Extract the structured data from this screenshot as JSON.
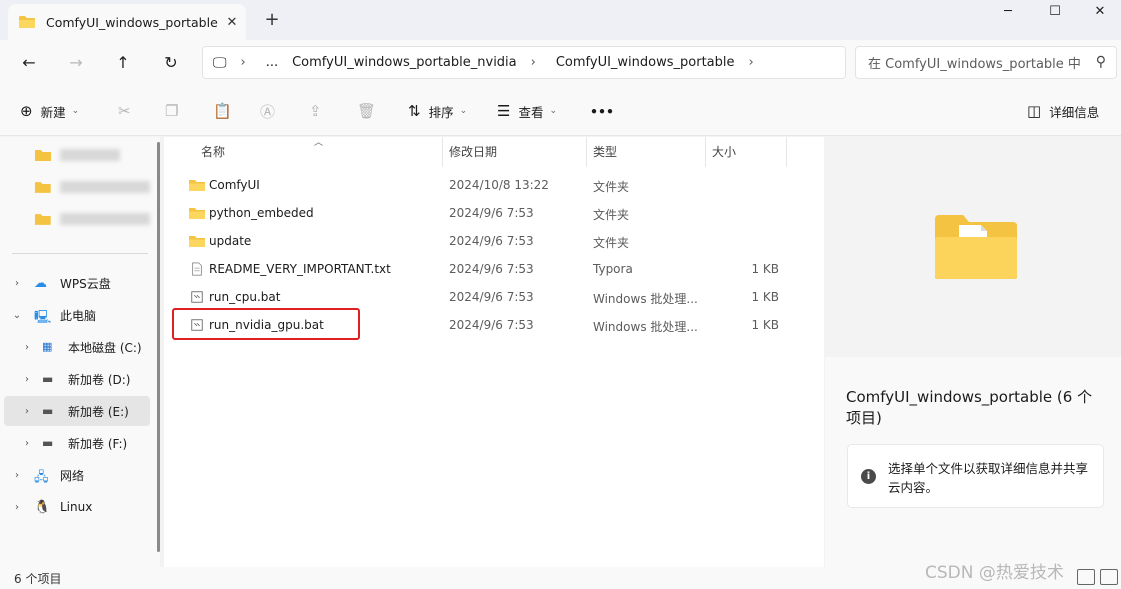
{
  "window": {
    "tab_title": "ComfyUI_windows_portable",
    "tab_close_icon": "close-icon",
    "new_tab_icon": "plus-icon",
    "controls": {
      "minimize": "─",
      "maximize": "☐",
      "close": "✕"
    }
  },
  "nav": {
    "back": "←",
    "forward": "→",
    "up": "↑",
    "refresh": "↻",
    "breadcrumb": [
      "...",
      "ComfyUI_windows_portable_nvidia",
      "ComfyUI_windows_portable"
    ],
    "search_placeholder": "在 ComfyUI_windows_portable 中"
  },
  "toolbar": {
    "new_label": "新建",
    "sort_label": "排序",
    "view_label": "查看",
    "more_label": "•••",
    "details_label": "详细信息"
  },
  "sidebar": {
    "quick_items": [
      {
        "label": "",
        "icon": "folder-icon"
      },
      {
        "label": "",
        "icon": "folder-icon"
      },
      {
        "label": "",
        "icon": "folder-icon"
      }
    ],
    "items": [
      {
        "label": "WPS云盘",
        "icon": "cloud-icon"
      },
      {
        "label": "此电脑",
        "icon": "pc-icon"
      },
      {
        "label": "本地磁盘 (C:)",
        "icon": "windows-drive-icon"
      },
      {
        "label": "新加卷 (D:)",
        "icon": "drive-icon"
      },
      {
        "label": "新加卷 (E:)",
        "icon": "drive-icon"
      },
      {
        "label": "新加卷 (F:)",
        "icon": "drive-icon"
      },
      {
        "label": "网络",
        "icon": "network-icon"
      },
      {
        "label": "Linux",
        "icon": "linux-icon"
      }
    ]
  },
  "columns": {
    "name": "名称",
    "date": "修改日期",
    "type": "类型",
    "size": "大小"
  },
  "files": [
    {
      "name": "ComfyUI",
      "date": "2024/10/8 13:22",
      "type": "文件夹",
      "size": "",
      "icon": "folder-icon"
    },
    {
      "name": "python_embeded",
      "date": "2024/9/6 7:53",
      "type": "文件夹",
      "size": "",
      "icon": "folder-icon"
    },
    {
      "name": "update",
      "date": "2024/9/6 7:53",
      "type": "文件夹",
      "size": "",
      "icon": "folder-icon"
    },
    {
      "name": "README_VERY_IMPORTANT.txt",
      "date": "2024/9/6 7:53",
      "type": "Typora",
      "size": "1 KB",
      "icon": "text-file-icon"
    },
    {
      "name": "run_cpu.bat",
      "date": "2024/9/6 7:53",
      "type": "Windows 批处理...",
      "size": "1 KB",
      "icon": "bat-file-icon"
    },
    {
      "name": "run_nvidia_gpu.bat",
      "date": "2024/9/6 7:53",
      "type": "Windows 批处理...",
      "size": "1 KB",
      "icon": "bat-file-icon"
    }
  ],
  "details_pane": {
    "title": "ComfyUI_windows_portable (6 个项目)",
    "info": "选择单个文件以获取详细信息并共享云内容。"
  },
  "status": {
    "count": "6 个项目"
  },
  "watermark": "CSDN @热爱技术",
  "colors": {
    "folder": "#f5c342",
    "highlight": "#e02020",
    "accent": "#0067c0"
  }
}
